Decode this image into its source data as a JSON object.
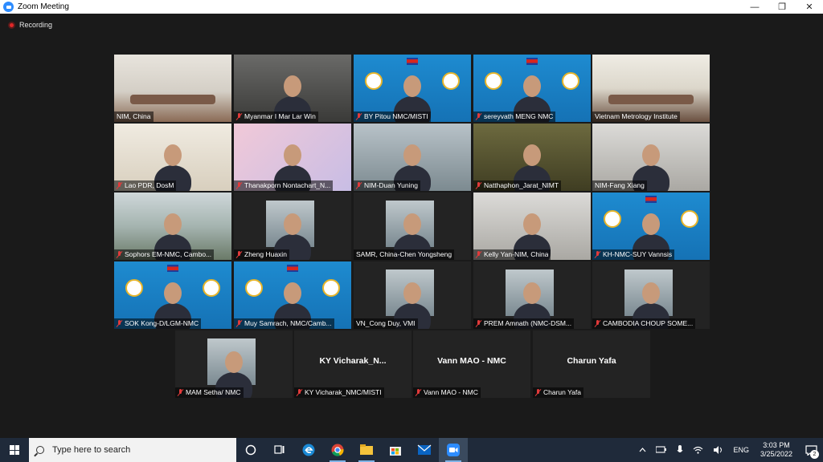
{
  "window": {
    "title": "Zoom Meeting",
    "controls": {
      "minimize": "—",
      "restore": "❐",
      "close": "✕"
    }
  },
  "meeting": {
    "recording_label": "Recording"
  },
  "participants": [
    {
      "name": "NIM, China",
      "muted": false,
      "active": true,
      "video": "room"
    },
    {
      "name": "Myanmar I Mar Lar Win",
      "muted": true,
      "video": "grey"
    },
    {
      "name": "BY Pitou NMC/MISTI",
      "muted": true,
      "video": "blue"
    },
    {
      "name": "sereyvath MENG NMC",
      "muted": true,
      "video": "blue"
    },
    {
      "name": "Vietnam Metrology Institute",
      "muted": false,
      "video": "room2"
    },
    {
      "name": "Lao PDR, DosM",
      "muted": true,
      "video": "wall"
    },
    {
      "name": "Thanakporn Nontachart_N...",
      "muted": true,
      "video": "pink"
    },
    {
      "name": "NIM-Duan Yuning",
      "muted": true,
      "video": "office"
    },
    {
      "name": "Natthaphon_Jarat_NIMT",
      "muted": true,
      "video": "olive"
    },
    {
      "name": "NIM-Fang Xiang",
      "muted": false,
      "video": "light"
    },
    {
      "name": "Sophors EM-NMC, Cambo...",
      "muted": true,
      "video": "sky"
    },
    {
      "name": "Zheng Huaxin",
      "muted": true,
      "video": "inset"
    },
    {
      "name": "SAMR, China-Chen Yongsheng",
      "muted": false,
      "video": "inset"
    },
    {
      "name": "Kelly Yan-NIM, China",
      "muted": true,
      "video": "light"
    },
    {
      "name": "KH-NMC-SUY Vannsis",
      "muted": true,
      "video": "blue"
    },
    {
      "name": "SOK Kong-D/LGM-NMC",
      "muted": true,
      "video": "blue"
    },
    {
      "name": "Muy Samrach, NMC/Camb...",
      "muted": true,
      "video": "blue"
    },
    {
      "name": "VN_Cong Duy, VMI",
      "muted": false,
      "video": "inset"
    },
    {
      "name": "PREM Amnath (NMC-DSM...",
      "muted": true,
      "video": "inset"
    },
    {
      "name": "CAMBODIA CHOUP SOME...",
      "muted": true,
      "video": "inset"
    },
    {
      "name": "MAM Setha/ NMC",
      "muted": true,
      "video": "inset"
    },
    {
      "name": "KY Vicharak_NMC/MISTI",
      "muted": true,
      "video": "none",
      "display_name": "KY  Vicharak_N..."
    },
    {
      "name": "Vann MAO - NMC",
      "muted": true,
      "video": "none",
      "display_name": "Vann MAO - NMC"
    },
    {
      "name": "Charun Yafa",
      "muted": true,
      "video": "none",
      "display_name": "Charun Yafa"
    }
  ],
  "taskbar": {
    "search_placeholder": "Type here to search",
    "apps": [
      "task-view",
      "edge",
      "chrome",
      "file-explorer",
      "store",
      "mail",
      "zoom"
    ],
    "tray": {
      "language": "ENG",
      "time": "3:03 PM",
      "date": "3/25/2022",
      "notification_count": "2"
    }
  },
  "colors": {
    "active_speaker": "#d8e35b",
    "muted": "#e23a3a",
    "recording": "#e02828",
    "taskbar": "#1f2a3a",
    "zoom_blue": "#2D8CFF"
  }
}
